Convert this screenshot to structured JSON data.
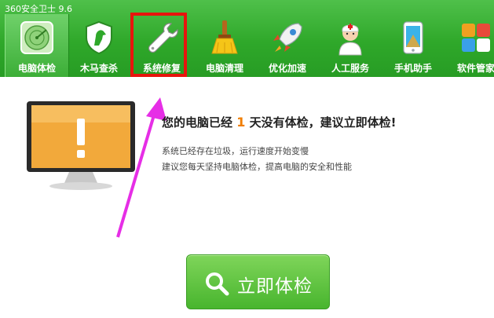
{
  "app": {
    "title": "360安全卫士 9.6"
  },
  "nav": {
    "items": [
      {
        "label": "电脑体检",
        "icon": "radar-icon"
      },
      {
        "label": "木马查杀",
        "icon": "horse-shield-icon"
      },
      {
        "label": "系统修复",
        "icon": "wrench-icon"
      },
      {
        "label": "电脑清理",
        "icon": "broom-icon"
      },
      {
        "label": "优化加速",
        "icon": "rocket-icon"
      },
      {
        "label": "人工服务",
        "icon": "support-agent-icon"
      },
      {
        "label": "手机助手",
        "icon": "phone-icon"
      },
      {
        "label": "软件管家",
        "icon": "apps-icon"
      }
    ],
    "active": "电脑体检",
    "highlighted": "系统修复"
  },
  "main": {
    "headline_prefix": "您的电脑已经",
    "days": "1",
    "headline_suffix": "天没有体检，建议立即体检",
    "headline_end": "!",
    "sub1": "系统已经存在垃圾，运行速度开始变慢",
    "sub2": "建议您每天坚持电脑体检，提高电脑的安全和性能"
  },
  "button": {
    "label": "立即体检"
  },
  "colors": {
    "topbar": "#2fa82a",
    "highlight": "#e8140d",
    "arrow": "#e62ee6",
    "days": "#f07d00"
  }
}
